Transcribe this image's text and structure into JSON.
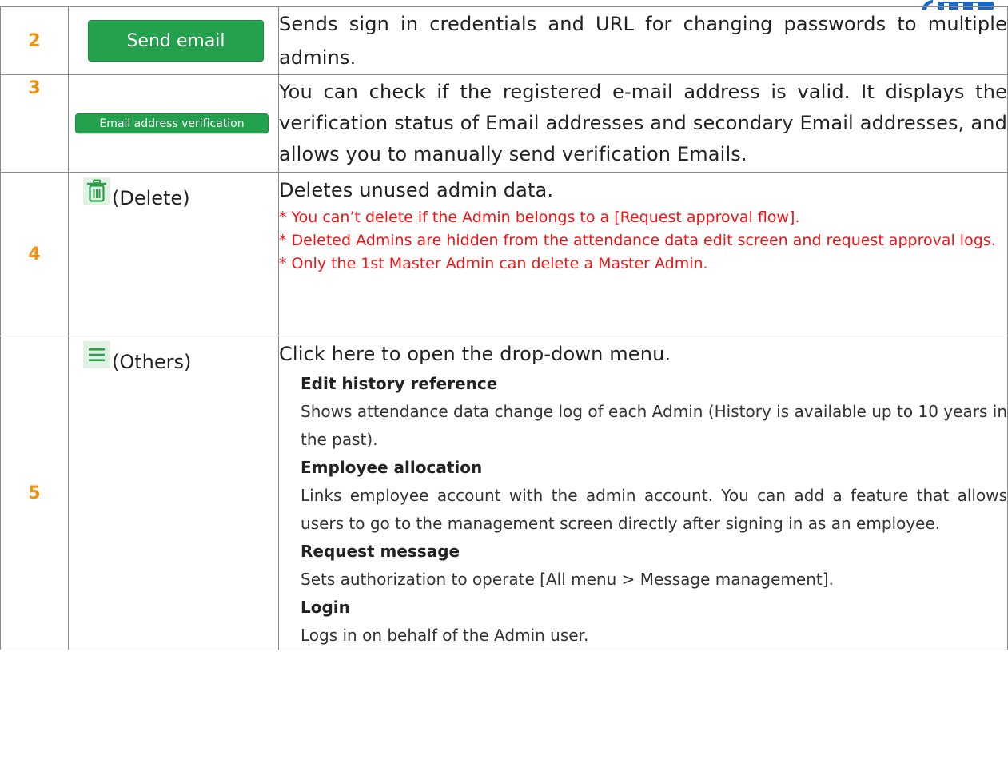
{
  "rows": [
    {
      "num": "2",
      "button_label": "Send email",
      "description": "Sends sign in credentials and URL for changing passwords to multiple admins."
    },
    {
      "num": "3",
      "button_label": "Email address verification",
      "description": "You can check if the registered e-mail address is valid. It displays the verification status of Email addresses and secondary Email addresses, and allows you to manually send verification Emails."
    },
    {
      "num": "4",
      "icon": "trash-icon",
      "control_label": "(Delete)",
      "description": "Deletes unused admin data.",
      "notes": [
        "* You can’t delete if the Admin belongs to a [Request approval flow].",
        "* Deleted Admins are hidden from the attendance data edit screen and request approval logs.",
        "* Only the 1st Master Admin can delete a Master Admin."
      ]
    },
    {
      "num": "5",
      "icon": "menu-icon",
      "control_label": "(Others)",
      "description": "Click here to open the drop-down menu.",
      "items": [
        {
          "heading": "Edit history reference",
          "text": "Shows attendance data change log of each Admin (History is available up to 10 years in the past)."
        },
        {
          "heading": "Employee allocation",
          "text": "Links employee account with the admin account. You can add a feature that allows users to go to the management screen directly after signing in as an employee."
        },
        {
          "heading": "Request message",
          "text": "Sets authorization to operate [All menu > Message management]."
        },
        {
          "heading": "Login",
          "text": "Logs in on behalf of the Admin user."
        }
      ]
    }
  ],
  "colors": {
    "number": "#f0930e",
    "button": "#24a14c",
    "note": "#f21414",
    "logo": "#1a66c4"
  }
}
